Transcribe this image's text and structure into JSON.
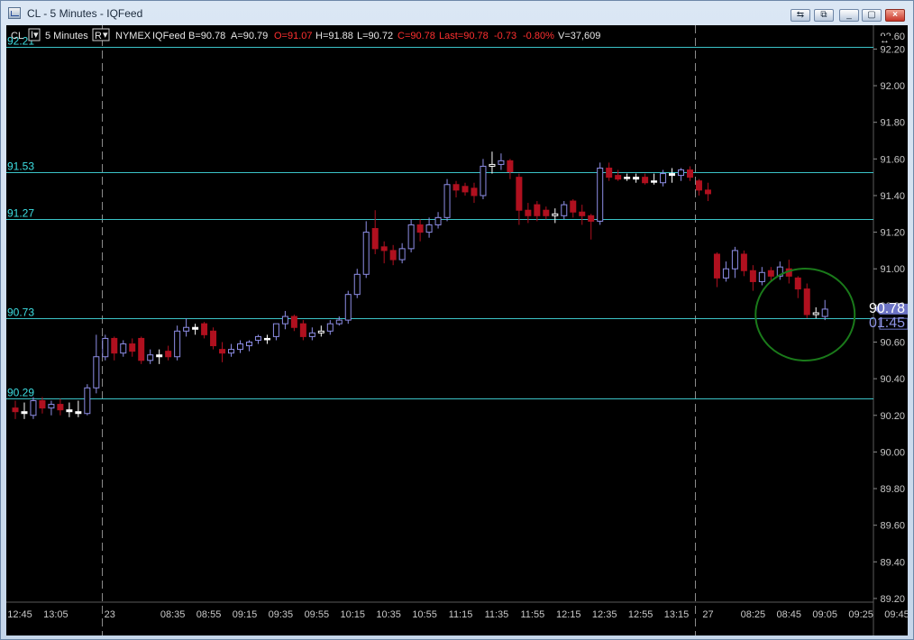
{
  "window": {
    "title": "CL - 5 Minutes - IQFeed",
    "buttons": [
      "⇆",
      "⧉",
      "_",
      "▢",
      "×"
    ]
  },
  "toolbar": {
    "symbol": "CL",
    "interval": "5 Minutes",
    "replay": "R",
    "exchange": "NYMEX",
    "feed": "IQFeed",
    "bid": "B=90.78",
    "ask": "A=90.79",
    "open": "O=91.07",
    "high": "H=91.88",
    "low": "L=90.72",
    "close": "C=90.78",
    "last": "Last=90.78",
    "change": "-0.73",
    "change_pct": "-0.80%",
    "volume": "V=37,609"
  },
  "chart_data": {
    "type": "candlestick",
    "ylim": [
      89.18,
      92.33
    ],
    "y_ticks": [
      92.4,
      92.2,
      92.0,
      91.8,
      91.6,
      91.4,
      91.2,
      91.0,
      90.8,
      90.6,
      90.4,
      90.2,
      90.0,
      89.8,
      89.6,
      89.4,
      89.2
    ],
    "y_tick_labels": [
      "92.40",
      "92.20",
      "92.00",
      "91.80",
      "91.60",
      "91.40",
      "91.20",
      "91.00",
      "90.80",
      "90.60",
      "90.40",
      "90.20",
      "90.00",
      "89.80",
      "89.60",
      "89.40",
      "89.20"
    ],
    "top_label": "92.60",
    "x_labels": [
      "12:45",
      "13:05",
      "23",
      "08:35",
      "08:55",
      "09:15",
      "09:35",
      "09:55",
      "10:15",
      "10:35",
      "10:55",
      "11:15",
      "11:35",
      "11:55",
      "12:15",
      "12:35",
      "12:55",
      "13:15",
      "27",
      "08:25",
      "08:45",
      "09:05",
      "09:25",
      "09:45"
    ],
    "x_label_slots": [
      0.5,
      4.5,
      10.5,
      17.5,
      21.5,
      25.5,
      29.5,
      33.5,
      37.5,
      41.5,
      45.5,
      49.5,
      53.5,
      57.5,
      61.5,
      65.5,
      69.5,
      73.5,
      77,
      82,
      86,
      90,
      94,
      98
    ],
    "session_breaks": [
      9.6,
      75.6
    ],
    "h_lines": [
      {
        "value": 92.21,
        "label": "92.21"
      },
      {
        "value": 91.53,
        "label": "91.53"
      },
      {
        "value": 91.27,
        "label": "91.27"
      },
      {
        "value": 90.73,
        "label": "90.73"
      },
      {
        "value": 90.29,
        "label": "90.29"
      }
    ],
    "candles": [
      {
        "slot": 0,
        "o": 90.24,
        "h": 90.28,
        "l": 90.18,
        "c": 90.22
      },
      {
        "slot": 1,
        "o": 90.22,
        "h": 90.27,
        "l": 90.18,
        "c": 90.21
      },
      {
        "slot": 2,
        "o": 90.2,
        "h": 90.3,
        "l": 90.18,
        "c": 90.28
      },
      {
        "slot": 3,
        "o": 90.28,
        "h": 90.3,
        "l": 90.21,
        "c": 90.24
      },
      {
        "slot": 4,
        "o": 90.24,
        "h": 90.28,
        "l": 90.2,
        "c": 90.26
      },
      {
        "slot": 5,
        "o": 90.26,
        "h": 90.29,
        "l": 90.2,
        "c": 90.23
      },
      {
        "slot": 6,
        "o": 90.23,
        "h": 90.27,
        "l": 90.19,
        "c": 90.22
      },
      {
        "slot": 7,
        "o": 90.22,
        "h": 90.28,
        "l": 90.19,
        "c": 90.21
      },
      {
        "slot": 8,
        "o": 90.21,
        "h": 90.37,
        "l": 90.2,
        "c": 90.35
      },
      {
        "slot": 9,
        "o": 90.35,
        "h": 90.64,
        "l": 90.32,
        "c": 90.52
      },
      {
        "slot": 10,
        "o": 90.52,
        "h": 90.64,
        "l": 90.5,
        "c": 90.62
      },
      {
        "slot": 11,
        "o": 90.62,
        "h": 90.63,
        "l": 90.5,
        "c": 90.54
      },
      {
        "slot": 12,
        "o": 90.54,
        "h": 90.61,
        "l": 90.52,
        "c": 90.59
      },
      {
        "slot": 13,
        "o": 90.59,
        "h": 90.62,
        "l": 90.52,
        "c": 90.55
      },
      {
        "slot": 14,
        "o": 90.62,
        "h": 90.63,
        "l": 90.48,
        "c": 90.5
      },
      {
        "slot": 15,
        "o": 90.5,
        "h": 90.56,
        "l": 90.48,
        "c": 90.53
      },
      {
        "slot": 16,
        "o": 90.53,
        "h": 90.56,
        "l": 90.48,
        "c": 90.52
      },
      {
        "slot": 17,
        "o": 90.55,
        "h": 90.58,
        "l": 90.5,
        "c": 90.52
      },
      {
        "slot": 18,
        "o": 90.52,
        "h": 90.69,
        "l": 90.5,
        "c": 90.66
      },
      {
        "slot": 19,
        "o": 90.66,
        "h": 90.73,
        "l": 90.63,
        "c": 90.68
      },
      {
        "slot": 20,
        "o": 90.68,
        "h": 90.7,
        "l": 90.64,
        "c": 90.67
      },
      {
        "slot": 21,
        "o": 90.7,
        "h": 90.71,
        "l": 90.62,
        "c": 90.64
      },
      {
        "slot": 22,
        "o": 90.66,
        "h": 90.68,
        "l": 90.56,
        "c": 90.58
      },
      {
        "slot": 23,
        "o": 90.56,
        "h": 90.6,
        "l": 90.49,
        "c": 90.54
      },
      {
        "slot": 24,
        "o": 90.54,
        "h": 90.59,
        "l": 90.52,
        "c": 90.56
      },
      {
        "slot": 25,
        "o": 90.56,
        "h": 90.61,
        "l": 90.54,
        "c": 90.59
      },
      {
        "slot": 26,
        "o": 90.58,
        "h": 90.61,
        "l": 90.55,
        "c": 90.6
      },
      {
        "slot": 27,
        "o": 90.61,
        "h": 90.64,
        "l": 90.59,
        "c": 90.63
      },
      {
        "slot": 28,
        "o": 90.62,
        "h": 90.64,
        "l": 90.59,
        "c": 90.62
      },
      {
        "slot": 29,
        "o": 90.63,
        "h": 90.7,
        "l": 90.61,
        "c": 90.7
      },
      {
        "slot": 30,
        "o": 90.7,
        "h": 90.77,
        "l": 90.67,
        "c": 90.74
      },
      {
        "slot": 31,
        "o": 90.74,
        "h": 90.75,
        "l": 90.66,
        "c": 90.68
      },
      {
        "slot": 32,
        "o": 90.7,
        "h": 90.72,
        "l": 90.61,
        "c": 90.63
      },
      {
        "slot": 33,
        "o": 90.63,
        "h": 90.68,
        "l": 90.61,
        "c": 90.65
      },
      {
        "slot": 34,
        "o": 90.65,
        "h": 90.69,
        "l": 90.63,
        "c": 90.66
      },
      {
        "slot": 35,
        "o": 90.66,
        "h": 90.72,
        "l": 90.64,
        "c": 90.7
      },
      {
        "slot": 36,
        "o": 90.7,
        "h": 90.74,
        "l": 90.69,
        "c": 90.72
      },
      {
        "slot": 37,
        "o": 90.72,
        "h": 90.88,
        "l": 90.7,
        "c": 90.86
      },
      {
        "slot": 38,
        "o": 90.86,
        "h": 91.0,
        "l": 90.84,
        "c": 90.97
      },
      {
        "slot": 39,
        "o": 90.97,
        "h": 91.26,
        "l": 90.95,
        "c": 91.2
      },
      {
        "slot": 40,
        "o": 91.22,
        "h": 91.32,
        "l": 91.08,
        "c": 91.11
      },
      {
        "slot": 41,
        "o": 91.12,
        "h": 91.15,
        "l": 91.03,
        "c": 91.1
      },
      {
        "slot": 42,
        "o": 91.1,
        "h": 91.13,
        "l": 91.02,
        "c": 91.05
      },
      {
        "slot": 43,
        "o": 91.05,
        "h": 91.14,
        "l": 91.03,
        "c": 91.11
      },
      {
        "slot": 44,
        "o": 91.11,
        "h": 91.27,
        "l": 91.09,
        "c": 91.24
      },
      {
        "slot": 45,
        "o": 91.24,
        "h": 91.27,
        "l": 91.15,
        "c": 91.2
      },
      {
        "slot": 46,
        "o": 91.2,
        "h": 91.28,
        "l": 91.17,
        "c": 91.24
      },
      {
        "slot": 47,
        "o": 91.24,
        "h": 91.31,
        "l": 91.22,
        "c": 91.28
      },
      {
        "slot": 48,
        "o": 91.28,
        "h": 91.49,
        "l": 91.26,
        "c": 91.46
      },
      {
        "slot": 49,
        "o": 91.46,
        "h": 91.48,
        "l": 91.39,
        "c": 91.43
      },
      {
        "slot": 50,
        "o": 91.45,
        "h": 91.47,
        "l": 91.4,
        "c": 91.42
      },
      {
        "slot": 51,
        "o": 91.44,
        "h": 91.47,
        "l": 91.36,
        "c": 91.4
      },
      {
        "slot": 52,
        "o": 91.4,
        "h": 91.6,
        "l": 91.38,
        "c": 91.56
      },
      {
        "slot": 53,
        "o": 91.56,
        "h": 91.64,
        "l": 91.52,
        "c": 91.57
      },
      {
        "slot": 54,
        "o": 91.57,
        "h": 91.63,
        "l": 91.54,
        "c": 91.59
      },
      {
        "slot": 55,
        "o": 91.59,
        "h": 91.6,
        "l": 91.49,
        "c": 91.53
      },
      {
        "slot": 56,
        "o": 91.5,
        "h": 91.52,
        "l": 91.24,
        "c": 91.32
      },
      {
        "slot": 57,
        "o": 91.32,
        "h": 91.36,
        "l": 91.25,
        "c": 91.29
      },
      {
        "slot": 58,
        "o": 91.35,
        "h": 91.37,
        "l": 91.26,
        "c": 91.29
      },
      {
        "slot": 59,
        "o": 91.32,
        "h": 91.34,
        "l": 91.27,
        "c": 91.29
      },
      {
        "slot": 60,
        "o": 91.29,
        "h": 91.33,
        "l": 91.25,
        "c": 91.3
      },
      {
        "slot": 61,
        "o": 91.29,
        "h": 91.37,
        "l": 91.27,
        "c": 91.35
      },
      {
        "slot": 62,
        "o": 91.37,
        "h": 91.38,
        "l": 91.28,
        "c": 91.31
      },
      {
        "slot": 63,
        "o": 91.31,
        "h": 91.35,
        "l": 91.24,
        "c": 91.29
      },
      {
        "slot": 64,
        "o": 91.29,
        "h": 91.3,
        "l": 91.16,
        "c": 91.26
      },
      {
        "slot": 65,
        "o": 91.26,
        "h": 91.58,
        "l": 91.24,
        "c": 91.55
      },
      {
        "slot": 66,
        "o": 91.55,
        "h": 91.58,
        "l": 91.48,
        "c": 91.5
      },
      {
        "slot": 67,
        "o": 91.51,
        "h": 91.54,
        "l": 91.48,
        "c": 91.49
      },
      {
        "slot": 68,
        "o": 91.5,
        "h": 91.52,
        "l": 91.48,
        "c": 91.5
      },
      {
        "slot": 69,
        "o": 91.5,
        "h": 91.52,
        "l": 91.47,
        "c": 91.49
      },
      {
        "slot": 70,
        "o": 91.5,
        "h": 91.52,
        "l": 91.46,
        "c": 91.47
      },
      {
        "slot": 71,
        "o": 91.48,
        "h": 91.52,
        "l": 91.46,
        "c": 91.48
      },
      {
        "slot": 72,
        "o": 91.47,
        "h": 91.54,
        "l": 91.45,
        "c": 91.52
      },
      {
        "slot": 73,
        "o": 91.52,
        "h": 91.55,
        "l": 91.47,
        "c": 91.51
      },
      {
        "slot": 74,
        "o": 91.51,
        "h": 91.55,
        "l": 91.48,
        "c": 91.54
      },
      {
        "slot": 75,
        "o": 91.54,
        "h": 91.56,
        "l": 91.48,
        "c": 91.5
      },
      {
        "slot": 76,
        "o": 91.48,
        "h": 91.49,
        "l": 91.4,
        "c": 91.43
      },
      {
        "slot": 77,
        "o": 91.43,
        "h": 91.47,
        "l": 91.37,
        "c": 91.41
      },
      {
        "slot": 78,
        "o": 91.08,
        "h": 91.09,
        "l": 90.9,
        "c": 90.95
      },
      {
        "slot": 79,
        "o": 90.95,
        "h": 91.04,
        "l": 90.93,
        "c": 91.0
      },
      {
        "slot": 80,
        "o": 91.0,
        "h": 91.12,
        "l": 90.95,
        "c": 91.1
      },
      {
        "slot": 81,
        "o": 91.08,
        "h": 91.1,
        "l": 90.96,
        "c": 90.99
      },
      {
        "slot": 82,
        "o": 90.99,
        "h": 91.02,
        "l": 90.88,
        "c": 90.93
      },
      {
        "slot": 83,
        "o": 90.93,
        "h": 91.01,
        "l": 90.91,
        "c": 90.98
      },
      {
        "slot": 84,
        "o": 90.99,
        "h": 91.01,
        "l": 90.93,
        "c": 90.96
      },
      {
        "slot": 85,
        "o": 90.96,
        "h": 91.04,
        "l": 90.94,
        "c": 91.01
      },
      {
        "slot": 86,
        "o": 91.0,
        "h": 91.05,
        "l": 90.92,
        "c": 90.96
      },
      {
        "slot": 87,
        "o": 90.95,
        "h": 90.96,
        "l": 90.84,
        "c": 90.89
      },
      {
        "slot": 88,
        "o": 90.89,
        "h": 90.92,
        "l": 90.73,
        "c": 90.75
      },
      {
        "slot": 89,
        "o": 90.75,
        "h": 90.79,
        "l": 90.73,
        "c": 90.76
      },
      {
        "slot": 90,
        "o": 90.74,
        "h": 90.83,
        "l": 90.72,
        "c": 90.78
      }
    ],
    "price_tag": {
      "value": 90.78,
      "label": "90.78"
    },
    "time_tag": {
      "value": 90.7,
      "label": "01:45"
    },
    "annotation": {
      "type": "ellipse",
      "slot": 87.8,
      "value": 90.75
    }
  },
  "colors": {
    "background": "#000000",
    "up_candle": "#8e8ee6",
    "down_candle": "#b0101f",
    "doji": "#ffffff",
    "level_line": "#3bc3c7",
    "level_label": "#3ddfe3",
    "axis_text": "#c8c8c8",
    "header_text": "#e6e6e6",
    "header_red": "#ff3030",
    "annotation": "#1a7a1a",
    "price_tag": "#6c73c4"
  }
}
